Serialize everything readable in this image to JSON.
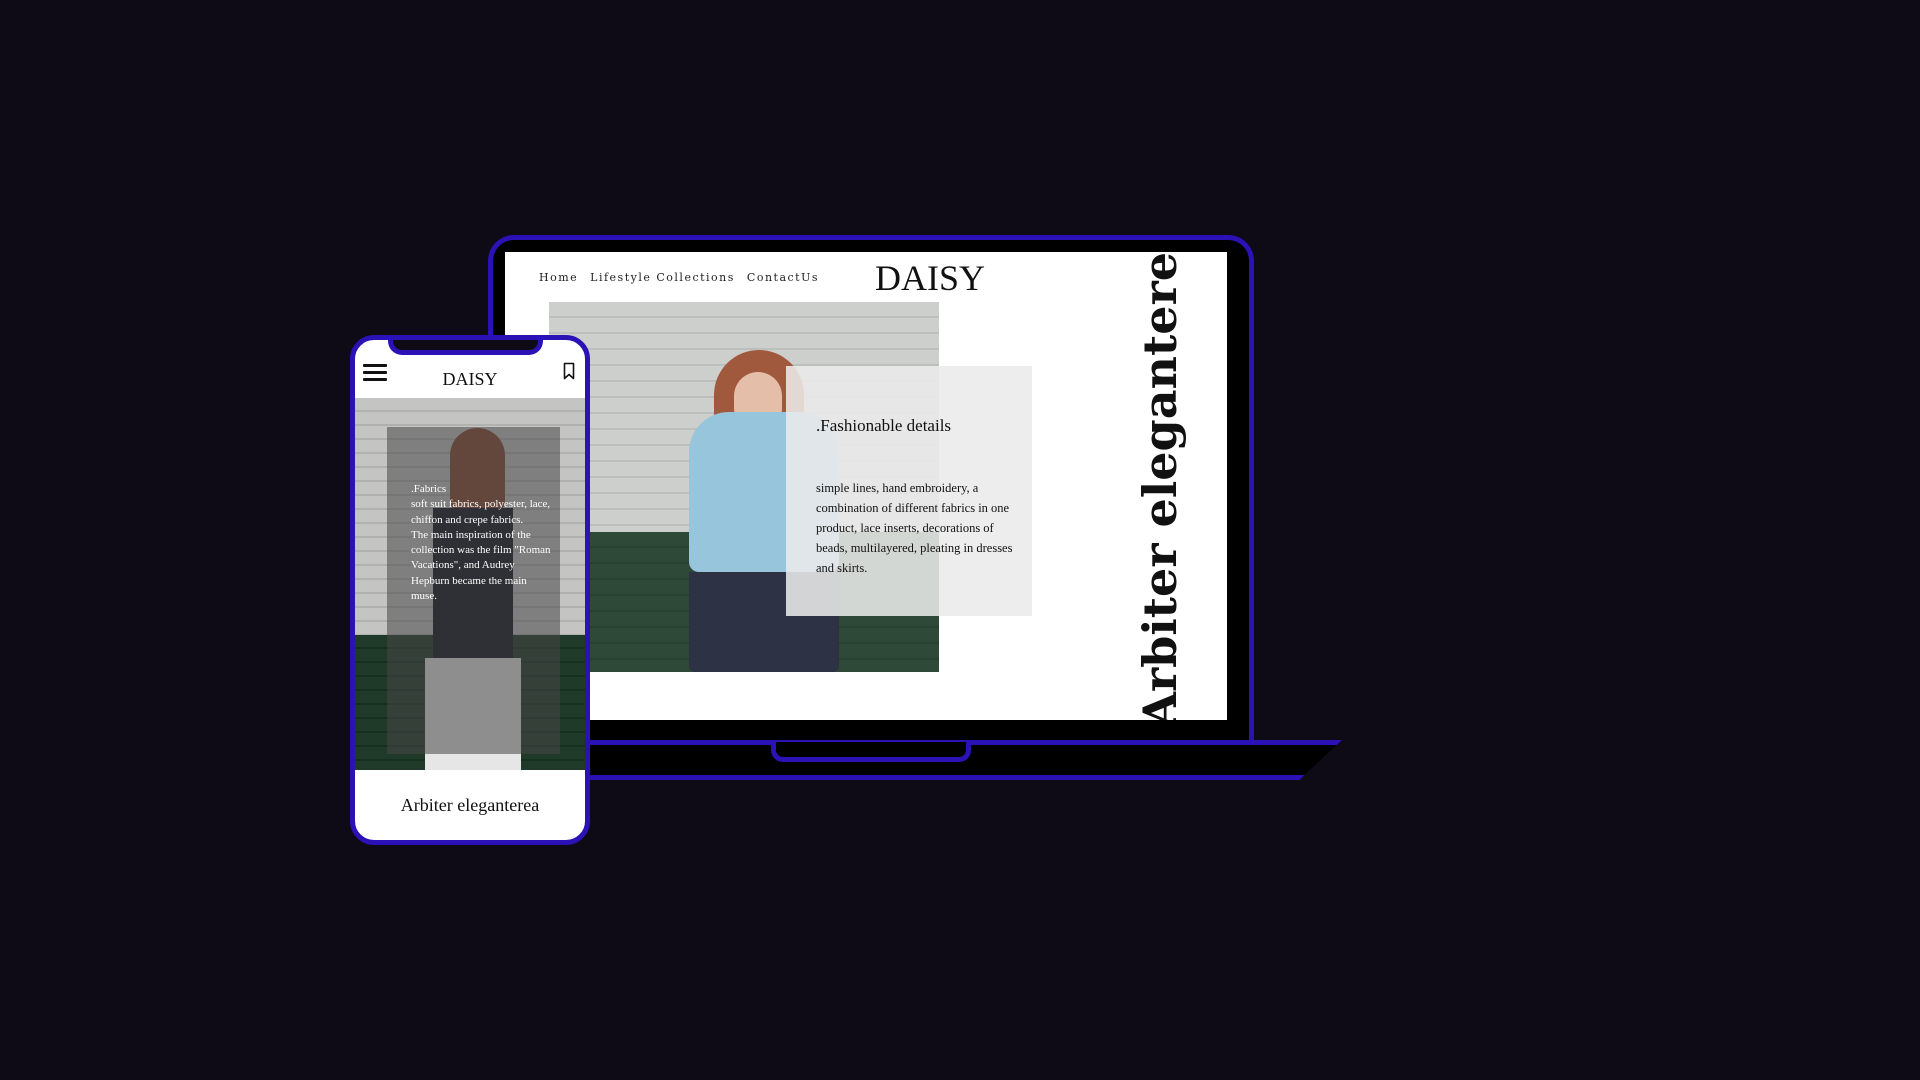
{
  "laptop": {
    "nav": {
      "home": "Home",
      "lifestyle": "Lifestyle Collections",
      "contact": "ContactUs"
    },
    "brand": "DAISY",
    "card": {
      "title": ".Fashionable details",
      "body": "simple lines, hand embroidery, a combination of different fabrics in one product, lace inserts, decorations of beads, multilayered, pleating in dresses and skirts."
    },
    "vertical_title": "Arbiter eleganterea"
  },
  "phone": {
    "brand": "DAISY",
    "overlay_text": ".Fabrics\nsoft suit fabrics, polyester, lace, chiffon and crepe fabrics.\nThe main inspiration of the collection was the film \"Roman Vacations\", and Audrey Hepburn became the main muse.",
    "footer_title": "Arbiter eleganterea"
  },
  "colors": {
    "background": "#0e0b17",
    "device_outline": "#2a12b6",
    "screen": "#ffffff"
  },
  "icons": {
    "menu": "hamburger-menu-icon",
    "bookmark": "bookmark-icon"
  }
}
